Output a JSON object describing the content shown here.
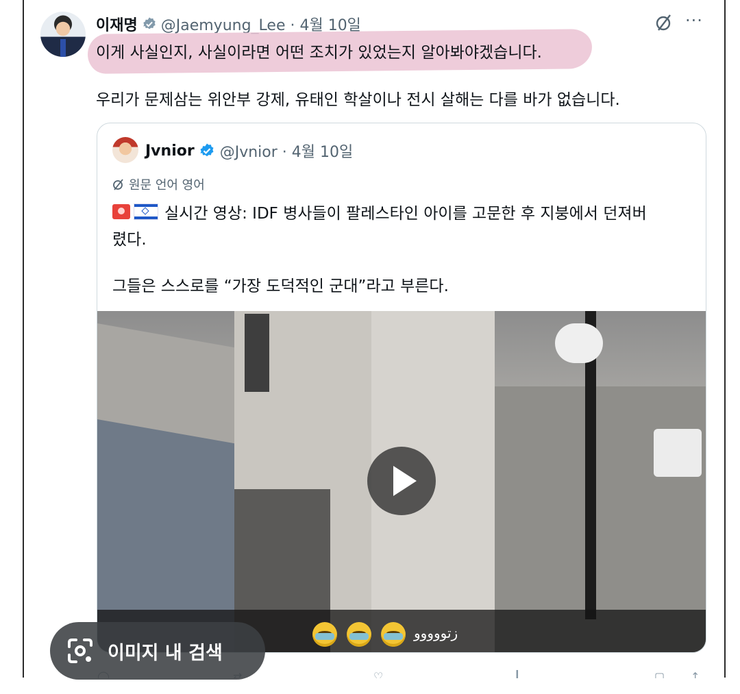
{
  "tweet": {
    "author_name": "이재명",
    "handle_date": "@Jaemyung_Lee · 4월 10일",
    "line1": "이게 사실인지, 사실이라면 어떤 조치가 있었는지 알아봐야겠습니다.",
    "line2": "우리가 문제삼는 위안부 강제, 유태인 학살이나 전시 살해는 다를 바가 없습니다."
  },
  "quoted": {
    "author_name": "Jvnior",
    "handle_date": "@Jvnior · 4월 10일",
    "translate_label": "원문 언어 영어",
    "line1": "실시간 영상: IDF 병사들이 팔레스타인 아이를 고문한 후 지붕에서 던져버",
    "line2": "렸다.",
    "line3": "그들은 스스로를 “가장 도덕적인 군대”라고 부른다.",
    "video_caption": "زتووووو"
  },
  "lens": {
    "label": "이미지 내 검색"
  },
  "icons": [
    "grok-icon",
    "more-icon",
    "verified-gray-icon",
    "verified-blue-icon",
    "translate-icon",
    "play-icon",
    "lens-camera-icon"
  ],
  "colors": {
    "highlight": "#ebc3d3",
    "verified_blue": "#1d9bf0",
    "secondary_text": "#536471"
  }
}
